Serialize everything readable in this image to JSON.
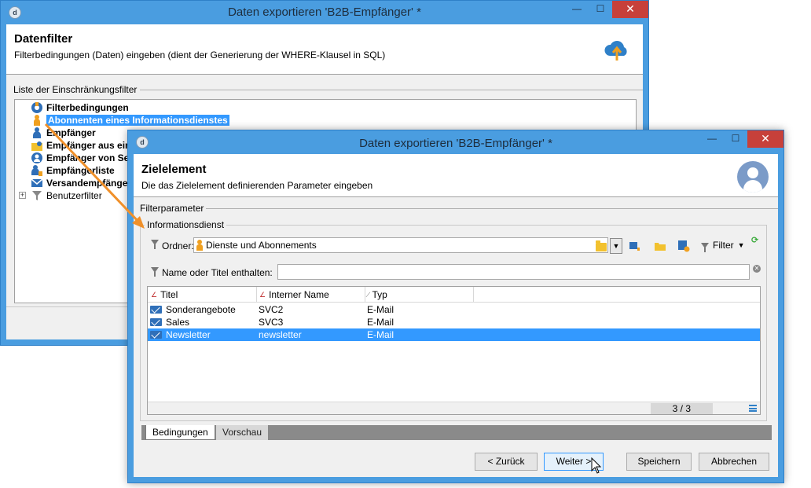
{
  "bg_window": {
    "title": "Daten exportieren 'B2B-Empfänger' *",
    "controls": {
      "minimize": "—",
      "maximize": "☐",
      "close": "✕"
    },
    "header": {
      "title": "Datenfilter",
      "subtitle": "Filterbedingungen (Daten) eingeben (dient der Generierung der WHERE-Klausel in SQL)"
    },
    "list_label": "Liste der Einschränkungsfilter",
    "tree": [
      {
        "label": "Filterbedingungen",
        "icon": "filter-conditions-icon",
        "selected": false
      },
      {
        "label": "Abonnenten eines Informationsdienstes",
        "icon": "subscriber-icon",
        "selected": true
      },
      {
        "label": "Empfänger",
        "icon": "recipient-icon",
        "selected": false
      },
      {
        "label": "Empfänger aus einer Liste",
        "icon": "recipient-folder-icon",
        "selected": false
      },
      {
        "label": "Empfänger von Sendungen",
        "icon": "recipient-delivery-icon",
        "selected": false
      },
      {
        "label": "Empfängerliste",
        "icon": "recipient-list-icon",
        "selected": false
      },
      {
        "label": "Versandempfänger",
        "icon": "delivery-recipient-icon",
        "selected": false
      },
      {
        "label": "Benutzerfilter",
        "icon": "user-filter-icon",
        "selected": false
      }
    ]
  },
  "dialog": {
    "title": "Daten exportieren 'B2B-Empfänger' *",
    "controls": {
      "minimize": "—",
      "maximize": "☐",
      "close": "✕"
    },
    "header": {
      "title": "Zielelement",
      "subtitle": "Die das Zielelement definierenden Parameter eingeben"
    },
    "filterparam_label": "Filterparameter",
    "service_group_label": "Informationsdienst",
    "folder_label": "Ordner:",
    "folder_value": "Dienste und Abonnements",
    "filter_button": "Filter",
    "name_filter_label": "Name oder Titel enthalten:",
    "name_filter_value": "",
    "columns": [
      "Titel",
      "Interner Name",
      "Typ"
    ],
    "rows": [
      {
        "titel": "Sonderangebote",
        "intern": "SVC2",
        "typ": "E-Mail",
        "selected": false
      },
      {
        "titel": "Sales",
        "intern": "SVC3",
        "typ": "E-Mail",
        "selected": false
      },
      {
        "titel": "Newsletter",
        "intern": "newsletter",
        "typ": "E-Mail",
        "selected": true
      }
    ],
    "counter": "3 / 3",
    "tabs": [
      {
        "label": "Bedingungen",
        "active": true
      },
      {
        "label": "Vorschau",
        "active": false
      }
    ],
    "buttons": {
      "back": "< Zurück",
      "next": "Weiter >",
      "save": "Speichern",
      "cancel": "Abbrechen"
    }
  },
  "colors": {
    "title_bar": "#4a9de0",
    "selection": "#3399ff",
    "annotation_arrow": "#f0902a",
    "close_button": "#c7403a"
  }
}
